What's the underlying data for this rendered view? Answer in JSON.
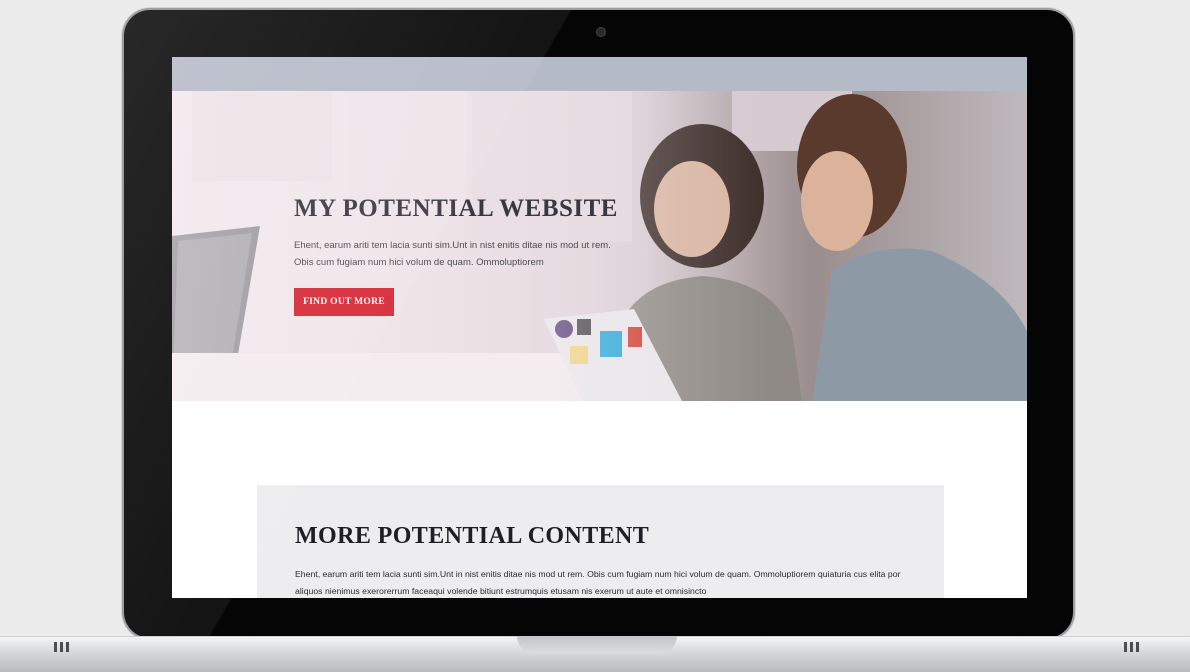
{
  "hero": {
    "title": "MY POTENTIAL WEBSITE",
    "description": "Ehent, earum ariti tem lacia sunti sim.Unt in nist enitis ditae nis mod ut rem. Obis cum fugiam num hici volum de quam. Ommoluptiorem",
    "button_label": "FIND OUT MORE"
  },
  "content": {
    "title": "MORE POTENTIAL CONTENT",
    "text": "Ehent, earum ariti tem lacia sunti sim.Unt in nist enitis ditae nis mod ut rem. Obis cum fugiam num hici volum de quam. Ommoluptiorem quiaturia cus elita por aliquos nienimus exerorerrum faceaqui volende bitiunt estrumquis etusam nis exerum ut aute et omnisincto"
  },
  "colors": {
    "accent": "#d62836",
    "topbar": "#b5bac7",
    "card_bg": "#ededef"
  }
}
